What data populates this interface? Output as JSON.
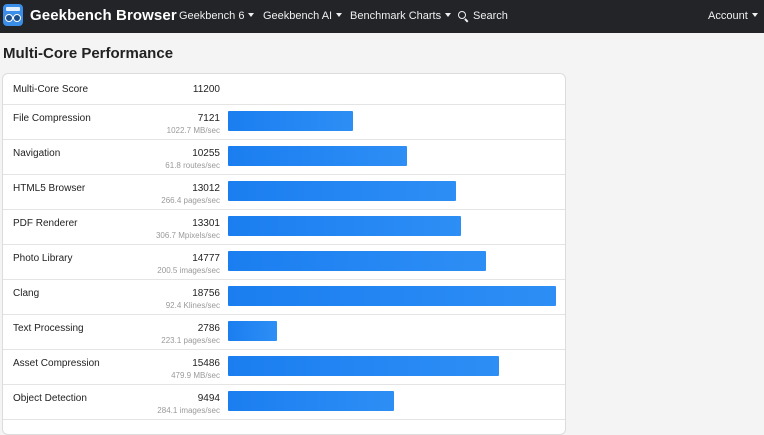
{
  "nav": {
    "brand": "Geekbench Browser",
    "items": [
      {
        "label": "Geekbench 6",
        "dropdown": true
      },
      {
        "label": "Geekbench AI",
        "dropdown": true
      },
      {
        "label": "Benchmark Charts",
        "dropdown": true
      }
    ],
    "search_label": "Search",
    "account_label": "Account"
  },
  "page": {
    "title": "Multi-Core Performance"
  },
  "summary": {
    "label": "Multi-Core Score",
    "score": "11200"
  },
  "max_bar_score": 18756,
  "benchmarks": [
    {
      "name": "File Compression",
      "score": 7121,
      "rate": "1022.7 MB/sec"
    },
    {
      "name": "Navigation",
      "score": 10255,
      "rate": "61.8 routes/sec"
    },
    {
      "name": "HTML5 Browser",
      "score": 13012,
      "rate": "266.4 pages/sec"
    },
    {
      "name": "PDF Renderer",
      "score": 13301,
      "rate": "306.7 Mpixels/sec"
    },
    {
      "name": "Photo Library",
      "score": 14777,
      "rate": "200.5 images/sec"
    },
    {
      "name": "Clang",
      "score": 18756,
      "rate": "92.4 Klines/sec"
    },
    {
      "name": "Text Processing",
      "score": 2786,
      "rate": "223.1 pages/sec"
    },
    {
      "name": "Asset Compression",
      "score": 15486,
      "rate": "479.9 MB/sec"
    },
    {
      "name": "Object Detection",
      "score": 9494,
      "rate": "284.1 images/sec"
    }
  ],
  "colors": {
    "bar": "#1b7ef0",
    "navbar": "#222428",
    "page_bg": "#f4f4f4"
  }
}
